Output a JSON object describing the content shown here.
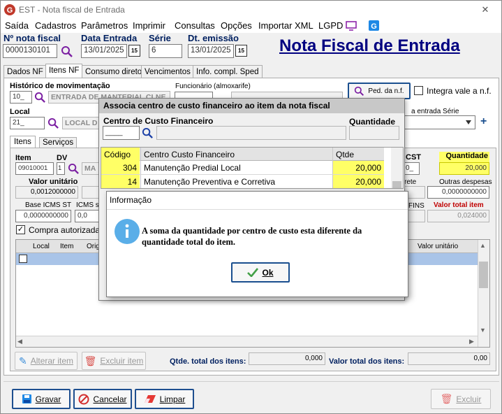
{
  "window": {
    "title": "EST - Nota fiscal de Entrada"
  },
  "menu": [
    "Saída",
    "Cadastros",
    "Parâmetros",
    "Imprimir",
    "Consultas",
    "Opções",
    "Importar XML",
    "LGPD"
  ],
  "header": {
    "nota_label": "Nº nota fiscal",
    "nota_value": "0000130101",
    "data_entrada_label": "Data Entrada",
    "data_entrada_value": "13/01/2025",
    "serie_label": "Série",
    "serie_value": "6",
    "dt_emissao_label": "Dt. emissão",
    "dt_emissao_value": "13/01/2025",
    "big_title": "Nota Fiscal de Entrada",
    "cal_glyph": "15"
  },
  "tabs": [
    "Dados NF",
    "Itens NF",
    "Consumo direto",
    "Vencimentos",
    "Info. compl. Sped"
  ],
  "itens_tab": {
    "historico_label": "Histórico de movimentação",
    "historico_code": "10_",
    "historico_desc": "ENTRADA DE MANTERIAL CLNE",
    "funcionario_label": "Funcionário (almoxarife)",
    "ped_button": "Ped. da n.f.",
    "integra_label": "Integra vale a n.f.",
    "local_label": "Local",
    "local_code": "21_",
    "local_desc": "LOCAL D",
    "entrada_serie_label": "a entrada  Série",
    "subtabs": [
      "Itens",
      "Serviços"
    ],
    "item_label": "Item",
    "item_value": "09010001",
    "dv_label": "DV",
    "dv_value": "1",
    "desc_partial": "MA",
    "cst_label": "CST",
    "cst_value": "0_",
    "quantidade_label": "Quantidade",
    "quantidade_value": "20,000",
    "valor_unitario_label": "Valor unitário",
    "valor_unitario_value": "0,0012000000",
    "frete_label": "rete",
    "outras_despesas_label": "Outras despesas",
    "outras_despesas_value": "0,0000000000",
    "base_icms_st_label": "Base ICMS ST",
    "base_icms_st_value": "0,0000000000",
    "icms_s_label": "ICMS s",
    "icms_s_value": "0,0",
    "fins_label": "FINS",
    "valor_total_item_label": "Valor total item",
    "valor_total_item_value": "0,024000",
    "compra_autorizada_label": "Compra autorizada",
    "grid_headers": [
      "Local",
      "Item",
      "Orig",
      "Valor unitário"
    ],
    "alterar_item": "Alterar item",
    "excluir_item": "Excluir item",
    "qtde_total_label": "Qtde. total dos itens:",
    "qtde_total_value": "0,000",
    "valor_total_label": "Valor total dos itens:",
    "valor_total_value": "0,00"
  },
  "bottom_buttons": {
    "gravar": "Gravar",
    "cancelar": "Cancelar",
    "limpar": "Limpar",
    "excluir": "Excluir"
  },
  "cc_dialog": {
    "title": "Associa centro de custo financeiro ao item da nota fiscal",
    "centro_label": "Centro de Custo Financeiro",
    "quantidade_label": "Quantidade",
    "centro_code": "____",
    "columns": [
      "Código",
      "Centro Custo Financeiro",
      "Qtde"
    ],
    "rows": [
      {
        "codigo": "304",
        "centro": "Manutenção Predial Local",
        "qtde": "20,000"
      },
      {
        "codigo": "14",
        "centro": "Manutenção Preventiva e Corretiva",
        "qtde": "20,000"
      }
    ]
  },
  "info_dialog": {
    "title": "Informação",
    "message_line1": "A soma da quantidade por centro de custo esta diferente da",
    "message_line2": "quantidade total do item.",
    "ok_label": "Ok"
  },
  "colors": {
    "accent": "#1a4f8f",
    "yellow": "#ffff66",
    "dialog_header": "#c8c8c8",
    "title_blue": "#000080",
    "red_label": "#c00000"
  }
}
